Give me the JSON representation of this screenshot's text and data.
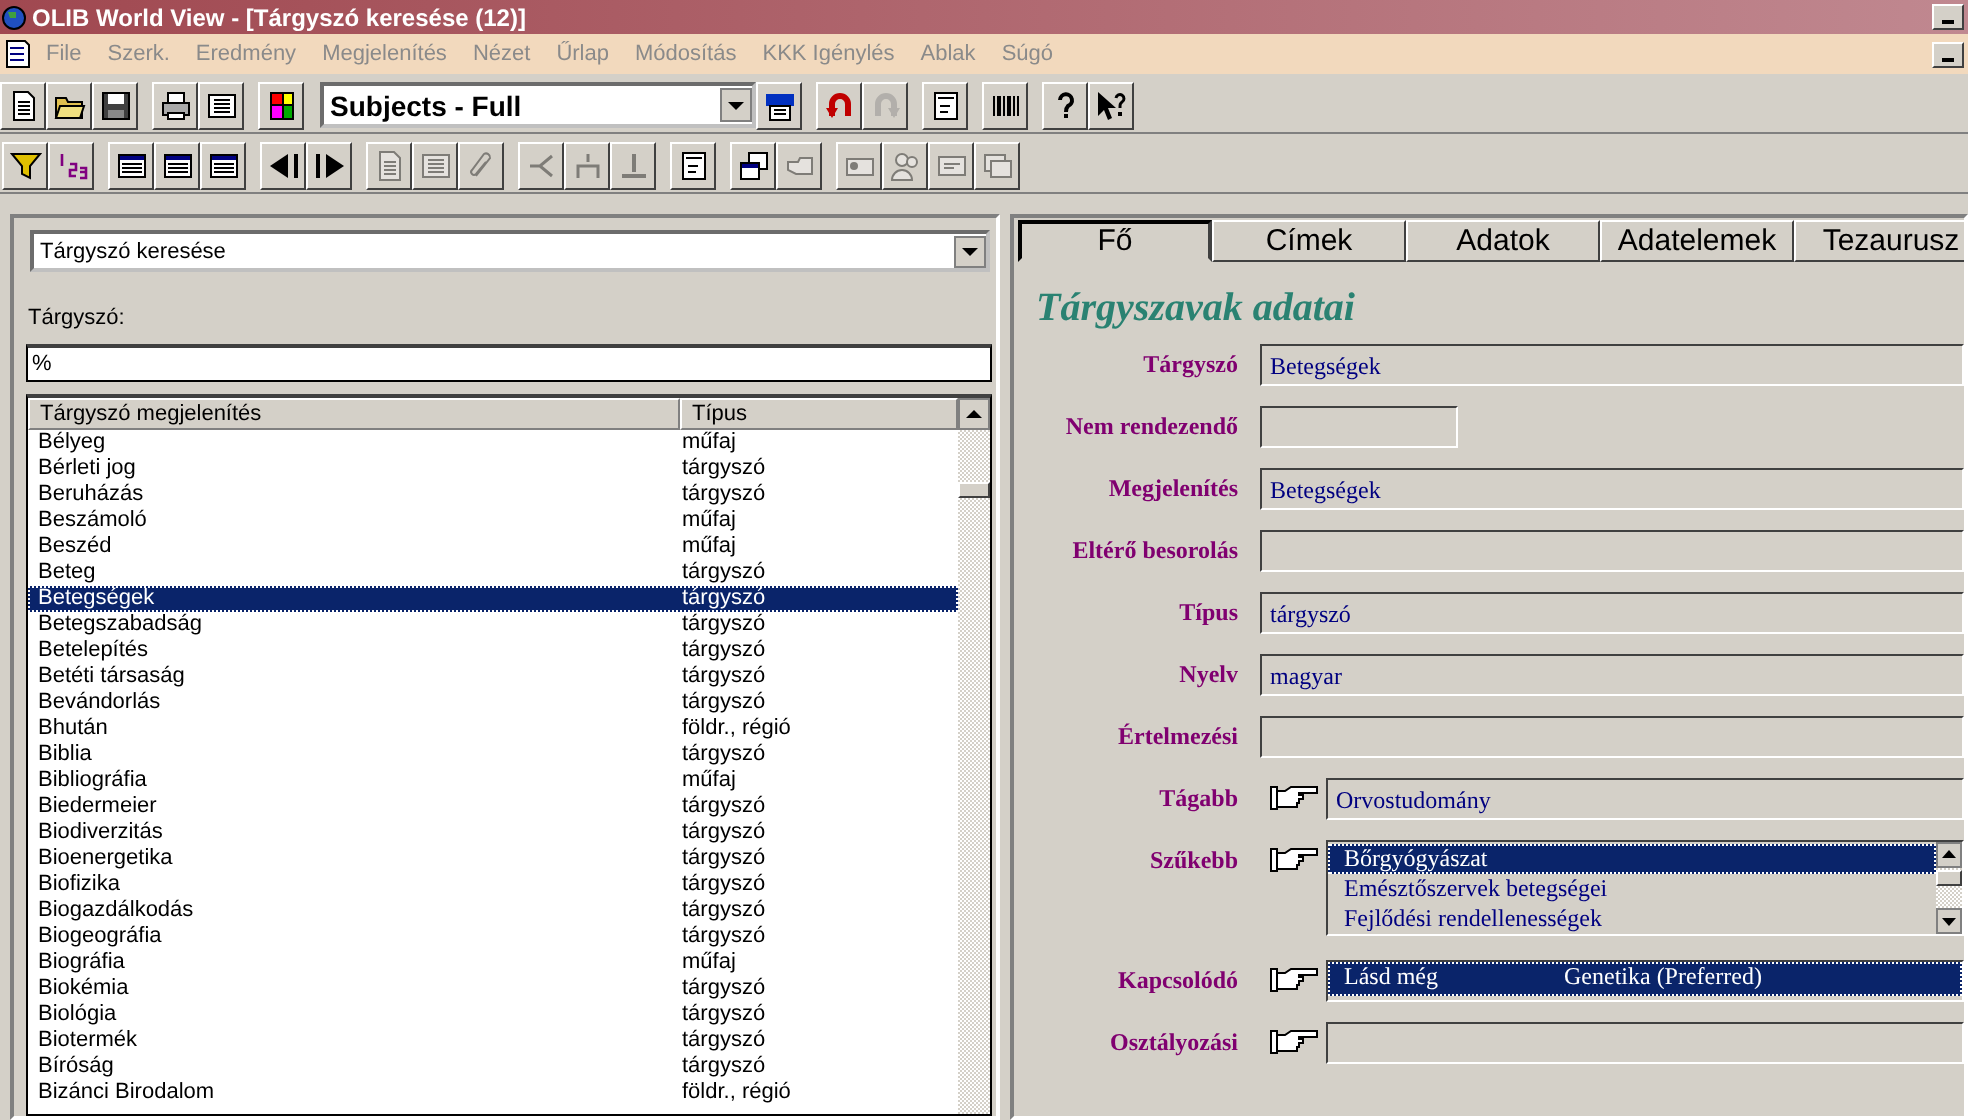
{
  "window": {
    "title": "OLIB World View - [Tárgyszó keresése (12)]"
  },
  "menu": [
    "File",
    "Szerk.",
    "Eredmény",
    "Megjelenítés",
    "Nézet",
    "Űrlap",
    "Módosítás",
    "KKK Igénylés",
    "Ablak",
    "Súgó"
  ],
  "toolbar_1": {
    "buttons_before": [
      {
        "disabled": false
      },
      {
        "disabled": false
      },
      {
        "disabled": false
      },
      {
        "disabled": false
      },
      {
        "disabled": false
      },
      {
        "disabled": false
      }
    ],
    "view_selector": "Subjects - Full",
    "buttons_after": [
      {
        "disabled": false
      },
      {
        "disabled": false
      },
      {
        "disabled": true
      },
      {
        "disabled": false
      },
      {
        "disabled": false
      },
      {
        "disabled": false
      },
      {
        "disabled": false
      }
    ]
  },
  "toolbar_2": [
    {
      "disabled": false
    },
    {
      "disabled": false
    },
    {
      "disabled": false
    },
    {
      "disabled": false
    },
    {
      "disabled": false
    },
    {
      "disabled": false
    },
    {
      "disabled": false
    },
    {
      "disabled": true
    },
    {
      "disabled": true
    },
    {
      "disabled": true
    },
    {
      "disabled": true
    },
    {
      "disabled": true
    },
    {
      "disabled": true
    },
    {
      "disabled": false
    },
    {
      "disabled": false
    },
    {
      "disabled": true
    },
    {
      "disabled": true
    },
    {
      "disabled": true
    },
    {
      "disabled": true
    },
    {
      "disabled": true
    }
  ],
  "search_panel": {
    "search_type": "Tárgyszó keresése",
    "field_label": "Tárgyszó:",
    "field_value": "%",
    "columns": [
      "Tárgyszó megjelenítés",
      "Típus"
    ],
    "rows": [
      {
        "name": "Bélyeg",
        "type": "műfaj",
        "selected": false
      },
      {
        "name": "Bérleti jog",
        "type": "tárgyszó",
        "selected": false
      },
      {
        "name": "Beruházás",
        "type": "tárgyszó",
        "selected": false
      },
      {
        "name": "Beszámoló",
        "type": "műfaj",
        "selected": false
      },
      {
        "name": "Beszéd",
        "type": "műfaj",
        "selected": false
      },
      {
        "name": "Beteg",
        "type": "tárgyszó",
        "selected": false
      },
      {
        "name": "Betegségek",
        "type": "tárgyszó",
        "selected": true
      },
      {
        "name": "Betegszabadság",
        "type": "tárgyszó",
        "selected": false
      },
      {
        "name": "Betelepítés",
        "type": "tárgyszó",
        "selected": false
      },
      {
        "name": "Betéti társaság",
        "type": "tárgyszó",
        "selected": false
      },
      {
        "name": "Bevándorlás",
        "type": "tárgyszó",
        "selected": false
      },
      {
        "name": "Bhután",
        "type": "földr., régió",
        "selected": false
      },
      {
        "name": "Biblia",
        "type": "tárgyszó",
        "selected": false
      },
      {
        "name": "Bibliográfia",
        "type": "műfaj",
        "selected": false
      },
      {
        "name": "Biedermeier",
        "type": "tárgyszó",
        "selected": false
      },
      {
        "name": "Biodiverzitás",
        "type": "tárgyszó",
        "selected": false
      },
      {
        "name": "Bioenergetika",
        "type": "tárgyszó",
        "selected": false
      },
      {
        "name": "Biofizika",
        "type": "tárgyszó",
        "selected": false
      },
      {
        "name": "Biogazdálkodás",
        "type": "tárgyszó",
        "selected": false
      },
      {
        "name": "Biogeográfia",
        "type": "tárgyszó",
        "selected": false
      },
      {
        "name": "Biográfia",
        "type": "műfaj",
        "selected": false
      },
      {
        "name": "Biokémia",
        "type": "tárgyszó",
        "selected": false
      },
      {
        "name": "Biológia",
        "type": "tárgyszó",
        "selected": false
      },
      {
        "name": "Biotermék",
        "type": "tárgyszó",
        "selected": false
      },
      {
        "name": "Bíróság",
        "type": "tárgyszó",
        "selected": false
      },
      {
        "name": "Bizánci Birodalom",
        "type": "földr., régió",
        "selected": false
      }
    ]
  },
  "record_panel": {
    "tabs": [
      {
        "label": "Fő",
        "selected": true
      },
      {
        "label": "Címek",
        "selected": false
      },
      {
        "label": "Adatok",
        "selected": false
      },
      {
        "label": "Adatelemek",
        "selected": false
      },
      {
        "label": "Tezaurusz",
        "selected": false
      }
    ],
    "heading": "Tárgyszavak adatai",
    "fields": [
      {
        "kind": "text",
        "label": "Tárgyszó",
        "value": "Betegségek"
      },
      {
        "kind": "short",
        "label": "Nem rendezendő"
      },
      {
        "kind": "text",
        "label": "Megjelenítés",
        "value": "Betegségek"
      },
      {
        "kind": "text",
        "label": "Eltérő besorolás"
      },
      {
        "kind": "text",
        "label": "Típus",
        "value": "tárgyszó"
      },
      {
        "kind": "text",
        "label": "Nyelv",
        "value": "magyar"
      },
      {
        "kind": "text",
        "label": "Értelmezési"
      },
      {
        "kind": "link",
        "label": "Tágabb",
        "value": "Orvostudomány"
      },
      {
        "kind": "link_list",
        "label": "Szűkebb",
        "items": [
          {
            "text": "Bőrgyógyászat",
            "selected": true
          },
          {
            "text": "Emésztőszervek betegségei",
            "selected": false
          },
          {
            "text": "Fejlődési rendellenességek",
            "selected": false
          }
        ]
      },
      {
        "kind": "relation",
        "label": "Kapcsolódó",
        "items": [
          {
            "relation": "Lásd még",
            "term": "Genetika (Preferred)",
            "selected": true
          }
        ]
      },
      {
        "kind": "link",
        "label": "Osztályozási"
      }
    ]
  }
}
